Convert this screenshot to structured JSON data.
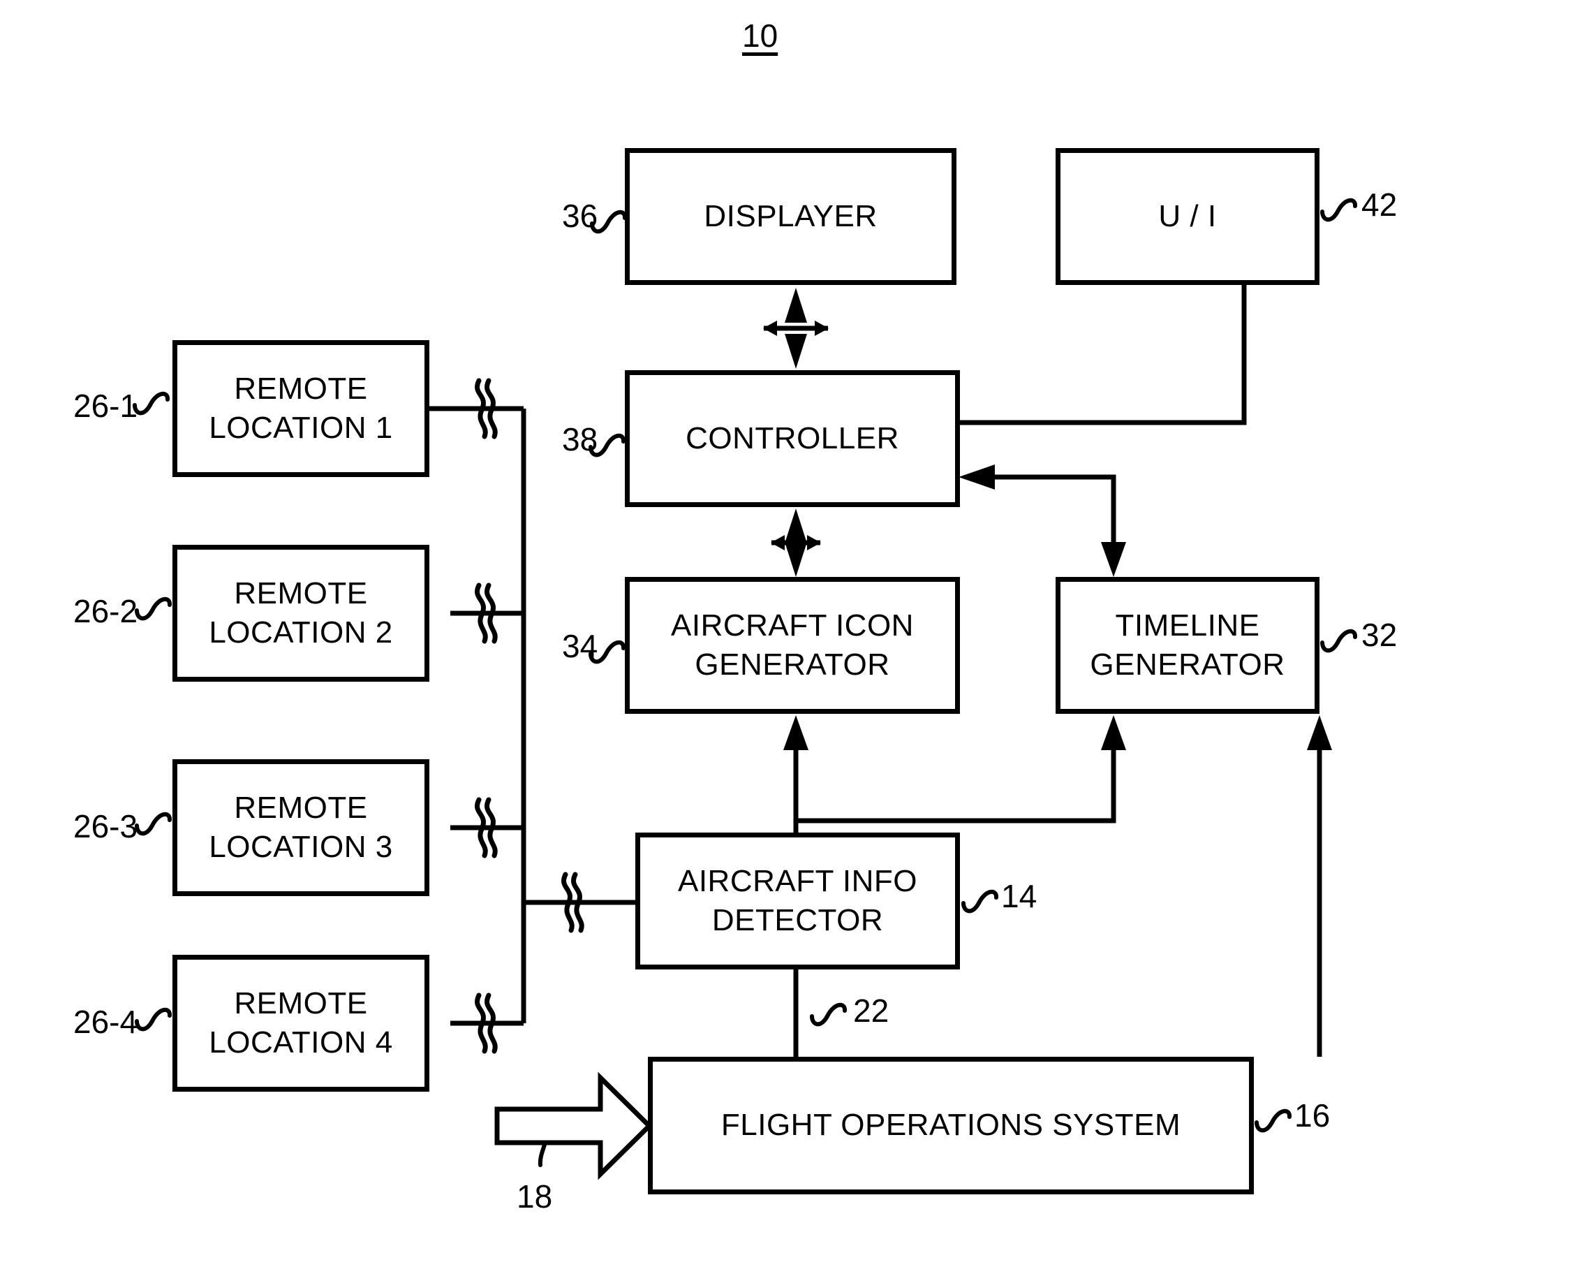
{
  "figure": {
    "number": "10"
  },
  "boxes": [
    {
      "id": "displayer",
      "label": "DISPLAYER",
      "ref": "36"
    },
    {
      "id": "ui",
      "label": "U / I",
      "ref": "42"
    },
    {
      "id": "controller",
      "label": "CONTROLLER",
      "ref": "38"
    },
    {
      "id": "aircraft_icon_gen",
      "label": "AIRCRAFT ICON\nGENERATOR",
      "ref": "34"
    },
    {
      "id": "timeline_gen",
      "label": "TIMELINE\nGENERATOR",
      "ref": "32"
    },
    {
      "id": "aircraft_info_det",
      "label": "AIRCRAFT INFO\nDETECTOR",
      "ref": "14"
    },
    {
      "id": "flight_ops",
      "label": "FLIGHT OPERATIONS SYSTEM",
      "ref": "16"
    },
    {
      "id": "remote_1",
      "label": "REMOTE\nLOCATION 1",
      "ref": "26-1"
    },
    {
      "id": "remote_2",
      "label": "REMOTE\nLOCATION 2",
      "ref": "26-2"
    },
    {
      "id": "remote_3",
      "label": "REMOTE\nLOCATION 3",
      "ref": "26-3"
    },
    {
      "id": "remote_4",
      "label": "REMOTE\nLOCATION 4",
      "ref": "26-4"
    }
  ],
  "refs": {
    "displayer": "36",
    "ui": "42",
    "controller": "38",
    "aircraft_icon_gen": "34",
    "timeline_gen": "32",
    "aircraft_info_det": "14",
    "flight_ops": "16",
    "input_arrow": "18",
    "detector_feed": "22",
    "remote_1": "26-1",
    "remote_2": "26-2",
    "remote_3": "26-3",
    "remote_4": "26-4"
  },
  "labels": {
    "displayer": "DISPLAYER",
    "ui": "U / I",
    "controller": "CONTROLLER",
    "aircraft_icon_gen": "AIRCRAFT ICON\nGENERATOR",
    "timeline_gen": "TIMELINE\nGENERATOR",
    "aircraft_info_det": "AIRCRAFT INFO\nDETECTOR",
    "flight_ops": "FLIGHT OPERATIONS SYSTEM",
    "remote_1": "REMOTE\nLOCATION 1",
    "remote_2": "REMOTE\nLOCATION 2",
    "remote_3": "REMOTE\nLOCATION 3",
    "remote_4": "REMOTE\nLOCATION 4"
  },
  "style": {
    "stroke": "#000000",
    "background": "#ffffff"
  }
}
